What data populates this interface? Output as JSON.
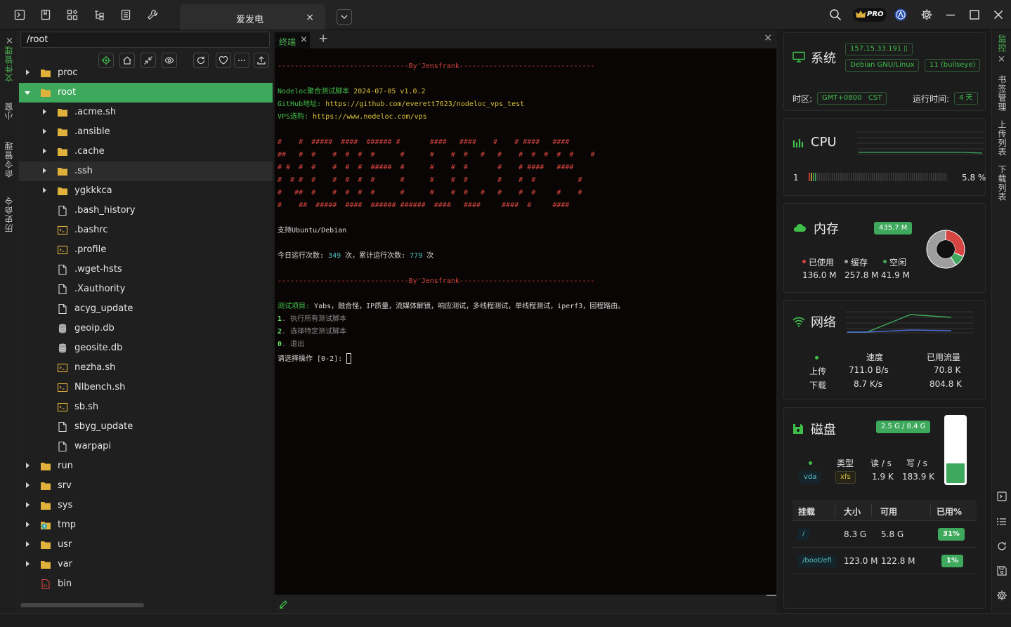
{
  "topbar": {
    "tab_title": "爱发电",
    "tab_close": "×",
    "pro_label": "PRO"
  },
  "left_rail": {
    "items": [
      "文件管理",
      "小窗",
      "命令管理",
      "历史命令"
    ]
  },
  "file_panel": {
    "path": "/root",
    "tree": [
      {
        "name": "proc",
        "type": "folder",
        "depth": 0,
        "expanded": false
      },
      {
        "name": "root",
        "type": "folder",
        "depth": 0,
        "expanded": true,
        "selected": true
      },
      {
        "name": ".acme.sh",
        "type": "folder",
        "depth": 1,
        "expanded": false
      },
      {
        "name": ".ansible",
        "type": "folder",
        "depth": 1,
        "expanded": false
      },
      {
        "name": ".cache",
        "type": "folder",
        "depth": 1,
        "expanded": false
      },
      {
        "name": ".ssh",
        "type": "folder",
        "depth": 1,
        "expanded": false,
        "hover": true
      },
      {
        "name": "ygkkkca",
        "type": "folder",
        "depth": 1,
        "expanded": false
      },
      {
        "name": ".bash_history",
        "type": "file",
        "depth": 1
      },
      {
        "name": ".bashrc",
        "type": "script",
        "depth": 1
      },
      {
        "name": ".profile",
        "type": "script",
        "depth": 1
      },
      {
        "name": ".wget-hsts",
        "type": "file",
        "depth": 1
      },
      {
        "name": ".Xauthority",
        "type": "file",
        "depth": 1
      },
      {
        "name": "acyg_update",
        "type": "file",
        "depth": 1
      },
      {
        "name": "geoip.db",
        "type": "db",
        "depth": 1
      },
      {
        "name": "geosite.db",
        "type": "db",
        "depth": 1
      },
      {
        "name": "nezha.sh",
        "type": "script",
        "depth": 1
      },
      {
        "name": "Nlbench.sh",
        "type": "script",
        "depth": 1
      },
      {
        "name": "sb.sh",
        "type": "script",
        "depth": 1
      },
      {
        "name": "sbyg_update",
        "type": "file",
        "depth": 1
      },
      {
        "name": "warpapi",
        "type": "file",
        "depth": 1
      },
      {
        "name": "run",
        "type": "folder",
        "depth": 0,
        "expanded": false
      },
      {
        "name": "srv",
        "type": "folder",
        "depth": 0,
        "expanded": false
      },
      {
        "name": "sys",
        "type": "folder",
        "depth": 0,
        "expanded": false
      },
      {
        "name": "tmp",
        "type": "tmpfolder",
        "depth": 0,
        "expanded": false
      },
      {
        "name": "usr",
        "type": "folder",
        "depth": 0,
        "expanded": false
      },
      {
        "name": "var",
        "type": "folder",
        "depth": 0,
        "expanded": false
      },
      {
        "name": "bin",
        "type": "binfile",
        "depth": 0
      }
    ]
  },
  "terminal": {
    "tab_label": "终端",
    "tab_close": "×",
    "add": "+",
    "close": "×",
    "divider_left": "-------------------------------",
    "divider_mid": "By'Jensfrank",
    "divider_right": "--------------------------------",
    "script_name_label": "Nodeloc聚合测试脚本 ",
    "script_date": "2024-07-05",
    "script_version": " v1.0.2",
    "github_label": "GitHub地址: ",
    "github_url": "https://github.com/everett7623/nodeloc_vps_test",
    "vps_label": "VPS选购: ",
    "vps_url": "https://www.nodeloc.com/vps",
    "ascii_art": [
      "#    #  #####  ####  ###### #       ####   ####    #    # ####   ####",
      "##   #  #    #  #  #  #      #      #    #  #   #   #    #  #  #  #  #    #",
      "# #  #  #    #  #  #  #####  #      #    #  #       #    # ####   ####",
      "#  # #  #    #  #  #  #      #      #    #  #       #    #  #          #",
      "#   ##  #    #  #  #  #      #      #    #  #   #   #    #  #     #    #",
      "#    ##  #####  ####  ###### ######  ####   ####     ####  #     ####"
    ],
    "support_text": "支持Ubuntu/Debian",
    "run_today_label": "今日运行次数: ",
    "run_today_count": "349",
    "run_total_label": " 次，累计运行次数: ",
    "run_total_count": "779",
    "run_suffix": " 次",
    "test_items_label": "测试项目: ",
    "test_items": "Yabs，融合怪，IP质量，流媒体解锁，响应测试，多线程测试，单线程测试，iperf3，回程路由。",
    "options": [
      {
        "key": "1",
        "label": ". 执行所有测试脚本"
      },
      {
        "key": "2",
        "label": ". 选择特定测试脚本"
      },
      {
        "key": "0",
        "label": ". 退出"
      }
    ],
    "prompt": "请选择操作 [0-2]: "
  },
  "monitor": {
    "system": {
      "title": "系统",
      "ip": "157.15.33.191",
      "os": "Debian GNU/Linux",
      "version": "11 (bullseye)",
      "tz_label": "时区:",
      "tz_value": "GMT+0800   CST",
      "uptime_label": "运行时间:",
      "uptime_value": "4 天"
    },
    "cpu": {
      "title": "CPU",
      "core": "1",
      "usage": "5.8 %",
      "usage_fraction": 0.058
    },
    "memory": {
      "title": "内存",
      "total": "435.7 M",
      "used_label": "已使用",
      "cache_label": "缓存",
      "free_label": "空闲",
      "used": "136.0 M",
      "cache": "257.8 M",
      "free": "41.9 M",
      "used_value": 136.0,
      "cache_value": 257.8,
      "free_value": 41.9,
      "colors": {
        "used": "#d64541",
        "cache": "#9e9e9e",
        "free": "#3ea85c"
      }
    },
    "network": {
      "title": "网络",
      "speed_label": "速度",
      "traffic_label": "已用流量",
      "up_label": "上传",
      "down_label": "下载",
      "up_speed": "711.0 B/s",
      "down_speed": "8.7 K/s",
      "up_traffic": "70.8 K",
      "down_traffic": "804.8 K"
    },
    "disk": {
      "title": "磁盘",
      "usage": "2.5 G / 8.4 G",
      "usage_fraction": 0.3,
      "type_label": "类型",
      "read_label": "读 / s",
      "write_label": "写 / s",
      "device": "vda",
      "fs": "xfs",
      "read": "1.9 K",
      "write": "183.9 K",
      "headers": [
        "挂载",
        "大小",
        "可用",
        "已用%"
      ],
      "rows": [
        {
          "mount": "/",
          "size": "8.3 G",
          "avail": "5.8 G",
          "used": "31%"
        },
        {
          "mount": "/boot/efi",
          "size": "123.0 M",
          "avail": "122.8 M",
          "used": "1%"
        }
      ]
    }
  },
  "right_rail": {
    "items": [
      "监控",
      "书签管理",
      "上传列表",
      "下载列表"
    ]
  },
  "colors": {
    "accent": "#3ea85c",
    "background": "#1c1c1c"
  }
}
